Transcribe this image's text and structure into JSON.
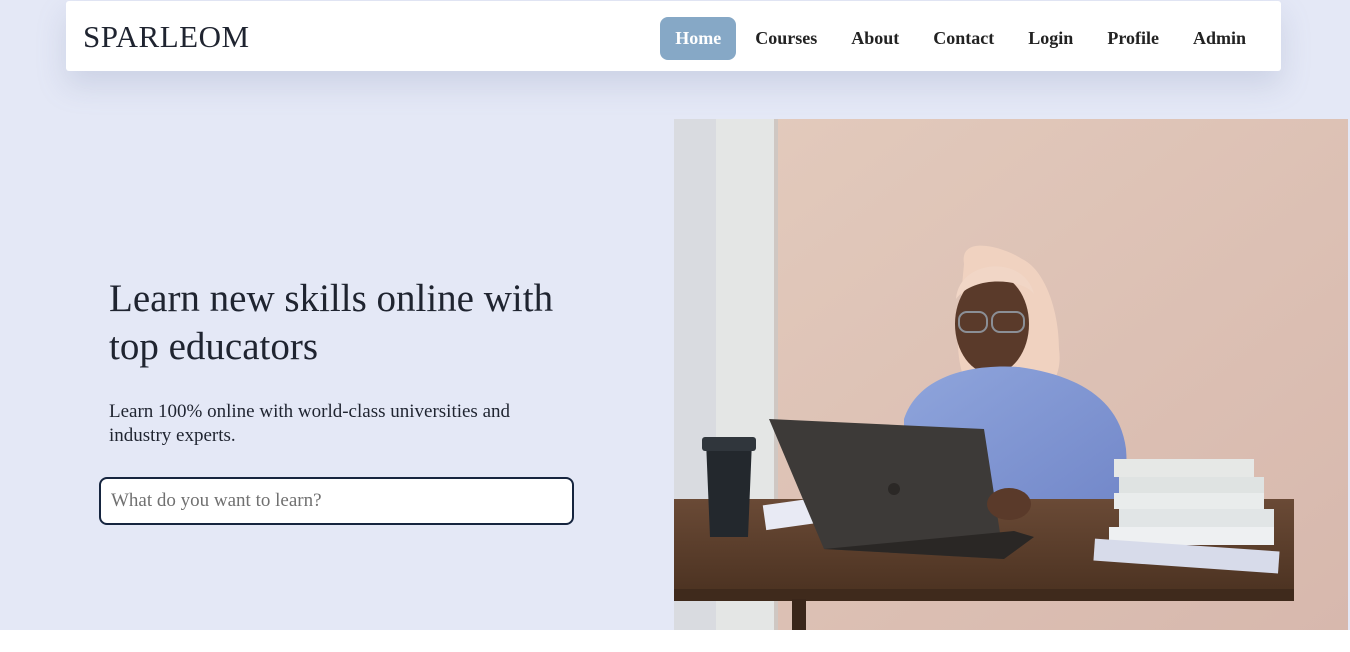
{
  "nav": {
    "brand": "SPARLEOM",
    "items": [
      {
        "label": "Home",
        "active": true
      },
      {
        "label": "Courses",
        "active": false
      },
      {
        "label": "About",
        "active": false
      },
      {
        "label": "Contact",
        "active": false
      },
      {
        "label": "Login",
        "active": false
      },
      {
        "label": "Profile",
        "active": false
      },
      {
        "label": "Admin",
        "active": false
      }
    ]
  },
  "hero": {
    "headline": "Learn new skills online with top educators",
    "subtext": "Learn 100% online with world-class universities and industry experts.",
    "search": {
      "value": "",
      "placeholder": "What do you want to learn?"
    }
  },
  "colors": {
    "hero_background": "#e4e8f6",
    "active_nav": "#86a8c6",
    "search_border": "#16253f"
  }
}
